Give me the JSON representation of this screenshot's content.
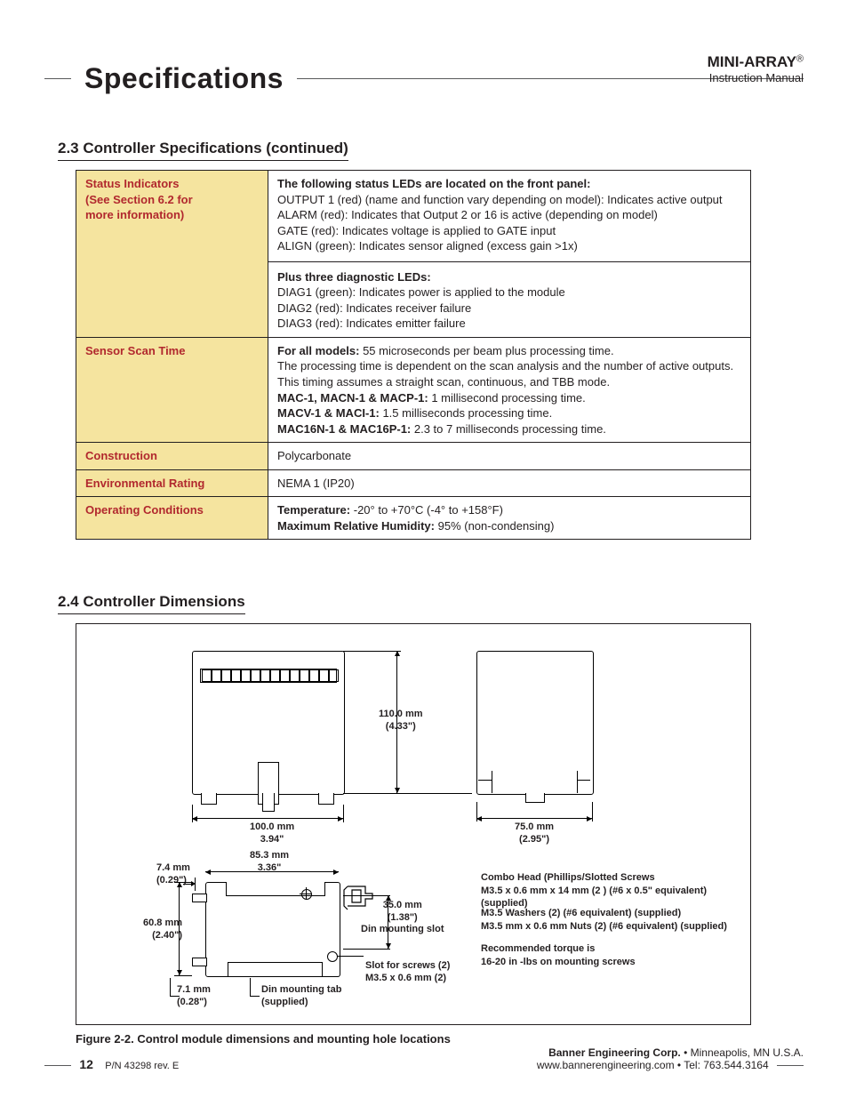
{
  "header": {
    "title": "Specifications",
    "brand": "MINI-ARRAY",
    "reg": "®",
    "manual": "Instruction Manual"
  },
  "s23": {
    "heading": "2.3  Controller Specifications (continued)"
  },
  "table": {
    "r1": {
      "label_l1": "Status Indicators",
      "label_l2": "(See Section 6.2 for",
      "label_l3": "more information)",
      "t1": "The following status LEDs are located on the front panel:",
      "t2": "OUTPUT 1 (red) (name and function vary depending on model): Indicates active output",
      "t3": "ALARM (red): Indicates that Output 2 or 16 is active (depending on model)",
      "t4": "GATE (red): Indicates voltage is applied to GATE input",
      "t5": "ALIGN (green): Indicates sensor aligned (excess gain >1x)",
      "t6": "Plus three diagnostic LEDs:",
      "t7": "DIAG1 (green): Indicates power is applied to the module",
      "t8": "DIAG2 (red): Indicates receiver failure",
      "t9": "DIAG3 (red): Indicates emitter failure"
    },
    "r2": {
      "label": "Sensor Scan Time",
      "t1a": "For all models:",
      "t1b": " 55 microseconds per beam plus processing time.",
      "t2": "The processing time is dependent on the scan analysis and the number of active outputs.",
      "t3": "This timing assumes a straight scan, continuous, and TBB mode.",
      "t4a": "MAC-1, MACN-1 & MACP-1:",
      "t4b": " 1 millisecond processing time.",
      "t5a": "MACV-1 & MACI-1:",
      "t5b": " 1.5 milliseconds processing time.",
      "t6a": "MAC16N-1 & MAC16P-1:",
      "t6b": " 2.3 to 7 milliseconds processing time."
    },
    "r3": {
      "label": "Construction",
      "val": "Polycarbonate"
    },
    "r4": {
      "label": "Environmental Rating",
      "val": "NEMA 1 (IP20)"
    },
    "r5": {
      "label": "Operating Conditions",
      "t1a": "Temperature:",
      "t1b": " -20° to +70°C (-4° to +158°F)",
      "t2a": "Maximum Relative Humidity:",
      "t2b": " 95% (non-condensing)"
    }
  },
  "s24": {
    "heading": "2.4  Controller Dimensions"
  },
  "dims": {
    "h110": "110.0 mm",
    "h110i": "(4.33\")",
    "w100": "100.0 mm",
    "w100i": "3.94\"",
    "w75": "75.0 mm",
    "w75i": "(2.95\")",
    "w85": "85.3 mm",
    "w85i": "3.36\"",
    "w7_4": "7.4 mm",
    "w7_4i": "(0.29\")",
    "h60": "60.8 mm",
    "h60i": "(2.40\")",
    "h35": "35.0 mm",
    "h35i": "(1.38\")",
    "dinslot": "Din mounting slot",
    "w7_1": "7.1 mm",
    "w7_1i": "(0.28\")",
    "dintab": "Din mounting tab",
    "dintab2": "(supplied)",
    "slotscrew1": "Slot for screws (2)",
    "slotscrew2": "M3.5 x 0.6 mm (2)"
  },
  "notes": {
    "n1a": "Combo Head (Phillips/Slotted Screws",
    "n1b": "M3.5 x 0.6 mm x 14 mm (2 ) (#6 x 0.5\" equivalent) (supplied)",
    "n2a": "M3.5 Washers (2) (#6 equivalent) (supplied)",
    "n2b": "M3.5 mm x 0.6 mm Nuts (2) (#6 equivalent) (supplied)",
    "n3a": "Recommended torque is",
    "n3b": "16-20 in -lbs on mounting screws"
  },
  "figure": {
    "caption": "Figure 2-2.  Control module dimensions and mounting hole locations"
  },
  "footer": {
    "page": "12",
    "pn": "P/N 43298 rev. E",
    "corp": "Banner Engineering Corp.",
    "loc": " • Minneapolis, MN U.S.A.",
    "web": "www.bannerengineering.com  •  Tel: 763.544.3164"
  },
  "chart_data": {
    "type": "diagram",
    "title": "Control module dimensions and mounting hole locations",
    "dimensions_mm": {
      "front_width": 100.0,
      "front_height": 110.0,
      "side_width": 75.0,
      "bottom_width": 85.3,
      "bottom_height": 60.8,
      "din_slot_depth": 35.0,
      "mounting_tab_offset": 7.4,
      "tab_detail": 7.1
    },
    "dimensions_in": {
      "front_width": 3.94,
      "front_height": 4.33,
      "side_width": 2.95,
      "bottom_width": 3.36,
      "bottom_height": 2.4,
      "din_slot_depth": 1.38,
      "mounting_tab_offset": 0.29,
      "tab_detail": 0.28
    },
    "hardware": {
      "screws": "Combo Head Phillips/Slotted M3.5 x 0.6 mm x 14 mm (2) (#6 x 0.5\" equiv) supplied",
      "washers": "M3.5 (2) (#6 equiv) supplied",
      "nuts": "M3.5 x 0.6 mm (2) (#6 equiv) supplied",
      "torque": "16-20 in-lbs",
      "screw_slots": "M3.5 x 0.6 mm (2)"
    }
  }
}
